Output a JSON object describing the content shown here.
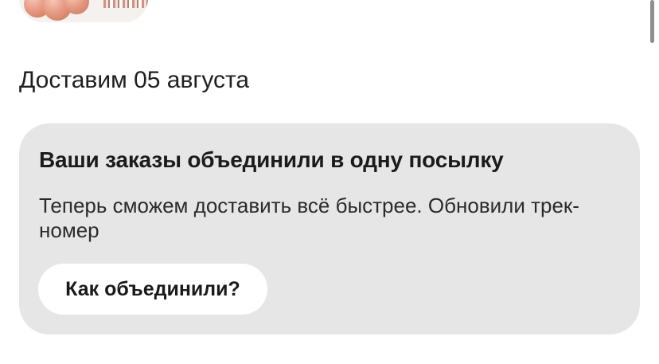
{
  "product": {
    "image_alt": "balloons and tassel garland"
  },
  "delivery": {
    "date_text": "Доставим 05 августа"
  },
  "notice": {
    "title": "Ваши заказы объединили в одну посылку",
    "text": "Теперь сможем доставить всё быстрее. Обновили трек-номер",
    "button_label": "Как объединили?"
  },
  "colors": {
    "card_background": "#e6e6e6",
    "button_background": "#ffffff",
    "text_primary": "#1f1f1f"
  }
}
